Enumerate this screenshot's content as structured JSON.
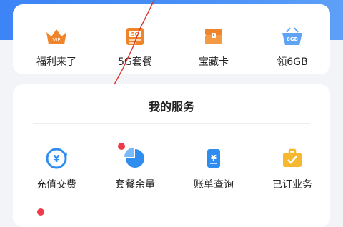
{
  "quick_links": [
    {
      "label": "福利来了",
      "icon": "crown-vip-icon",
      "badge": "VIP"
    },
    {
      "label": "5G套餐",
      "icon": "5g-package-icon",
      "badge": "5G"
    },
    {
      "label": "宝藏卡",
      "icon": "treasure-card-icon"
    },
    {
      "label": "领6GB",
      "icon": "data-basket-icon",
      "badge": "6GB"
    }
  ],
  "services": {
    "title": "我的服务",
    "items": [
      {
        "label": "充值交费",
        "icon": "recharge-yen-icon"
      },
      {
        "label": "套餐余量",
        "icon": "pie-chart-icon",
        "has_dot": true
      },
      {
        "label": "账单查询",
        "icon": "bill-icon"
      },
      {
        "label": "已订业务",
        "icon": "briefcase-check-icon"
      }
    ]
  },
  "colors": {
    "header_blue": "#3d84f6",
    "orange": "#f0842a",
    "blue": "#2f8df0",
    "red_dot": "#ee3a4a",
    "yellow": "#f5b82e"
  }
}
